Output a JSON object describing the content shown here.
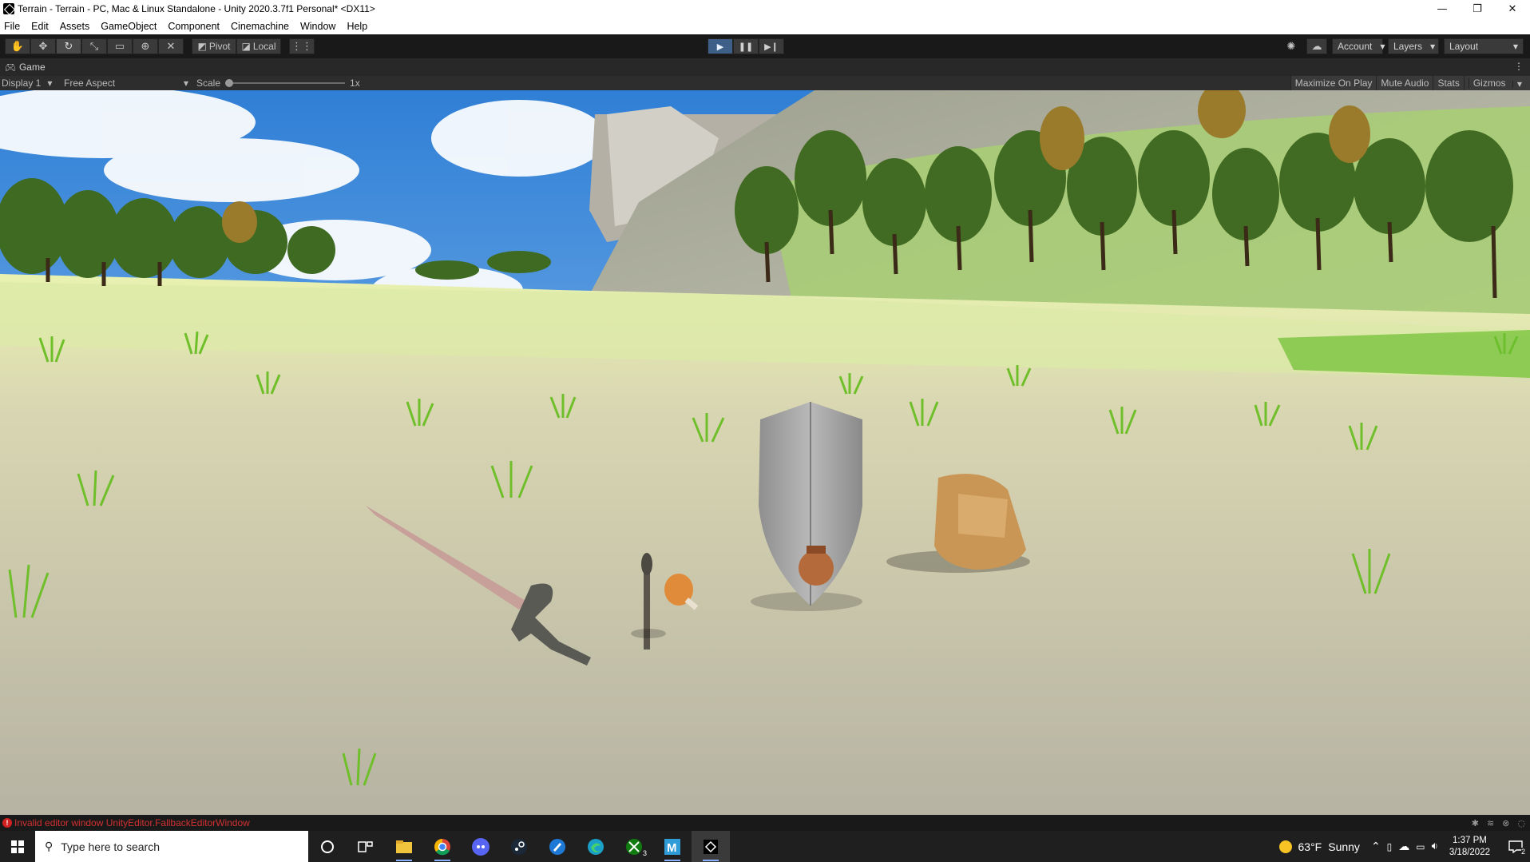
{
  "window": {
    "title": "Terrain - Terrain - PC, Mac & Linux Standalone - Unity 2020.3.7f1 Personal* <DX11>",
    "controls": [
      "—",
      "❐",
      "✕"
    ]
  },
  "menu": [
    "File",
    "Edit",
    "Assets",
    "GameObject",
    "Component",
    "Cinemachine",
    "Window",
    "Help"
  ],
  "toolbar": {
    "pivot_label": "Pivot",
    "local_label": "Local",
    "account_label": "Account",
    "layers_label": "Layers",
    "layout_label": "Layout"
  },
  "game_tab": {
    "title": "Game"
  },
  "game_bar": {
    "display": "Display 1",
    "aspect": "Free Aspect",
    "scale_label": "Scale",
    "scale_value": "1x",
    "maximize": "Maximize On Play",
    "mute": "Mute Audio",
    "stats": "Stats",
    "gizmos": "Gizmos"
  },
  "status": {
    "error": "Invalid editor window UnityEditor.FallbackEditorWindow"
  },
  "taskbar": {
    "search_placeholder": "Type here to search",
    "weather_temp": "63°F",
    "weather_text": "Sunny",
    "time": "1:37 PM",
    "date": "3/18/2022",
    "notification_count": "2",
    "xbox_badge": "3"
  },
  "colors": {
    "play_active": "#3e5f87",
    "sky": "#3f8fe0",
    "grass": "#7bc043",
    "error": "#d03030"
  }
}
